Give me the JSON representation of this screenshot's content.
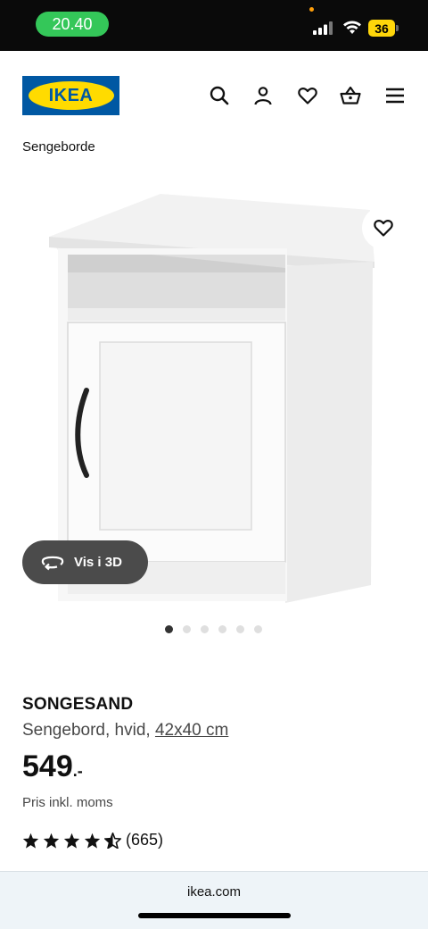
{
  "status_bar": {
    "time": "20.40",
    "battery": "36"
  },
  "header": {
    "logo_text": "IKEA"
  },
  "breadcrumb": "Sengeborde",
  "gallery": {
    "view_3d_label": "Vis i 3D",
    "image_count": 6,
    "active_index": 0
  },
  "product": {
    "name": "SONGESAND",
    "description": "Sengebord, hvid, ",
    "size": "42x40 cm",
    "price": "549",
    "price_suffix": ".-",
    "vat_note": "Pris inkl. moms",
    "rating": 4.5,
    "rating_count": "(665)"
  },
  "browser": {
    "url": "ikea.com"
  },
  "colors": {
    "ikea_blue": "#0058a3",
    "ikea_yellow": "#ffdb00",
    "status_green": "#34c759"
  }
}
